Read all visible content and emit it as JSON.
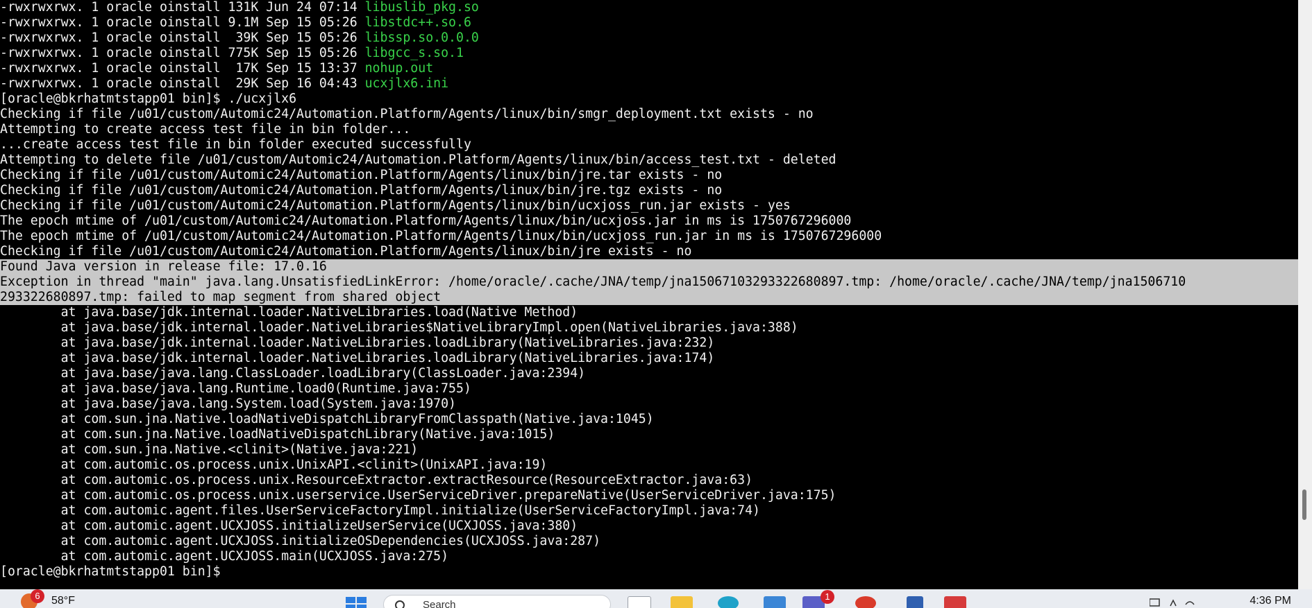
{
  "terminal": {
    "lines": [
      {
        "text": "-rwxrwxrwx. 1 oracle oinstall 131K Jun 24 07:14 ",
        "green": "libuslib_pkg.so"
      },
      {
        "text": "-rwxrwxrwx. 1 oracle oinstall 9.1M Sep 15 05:26 ",
        "green": "libstdc++.so.6"
      },
      {
        "text": "-rwxrwxrwx. 1 oracle oinstall  39K Sep 15 05:26 ",
        "green": "libssp.so.0.0.0"
      },
      {
        "text": "-rwxrwxrwx. 1 oracle oinstall 775K Sep 15 05:26 ",
        "green": "libgcc_s.so.1"
      },
      {
        "text": "-rwxrwxrwx. 1 oracle oinstall  17K Sep 15 13:37 ",
        "green": "nohup.out"
      },
      {
        "text": "-rwxrwxrwx. 1 oracle oinstall  29K Sep 16 04:43 ",
        "green": "ucxjlx6.ini"
      },
      {
        "text": "[oracle@bkrhatmtstapp01 bin]$ ./ucxjlx6"
      },
      {
        "text": "Checking if file /u01/custom/Automic24/Automation.Platform/Agents/linux/bin/smgr_deployment.txt exists - no"
      },
      {
        "text": "Attempting to create access test file in bin folder..."
      },
      {
        "text": "...create access test file in bin folder executed successfully"
      },
      {
        "text": "Attempting to delete file /u01/custom/Automic24/Automation.Platform/Agents/linux/bin/access_test.txt - deleted"
      },
      {
        "text": "Checking if file /u01/custom/Automic24/Automation.Platform/Agents/linux/bin/jre.tar exists - no"
      },
      {
        "text": "Checking if file /u01/custom/Automic24/Automation.Platform/Agents/linux/bin/jre.tgz exists - no"
      },
      {
        "text": "Checking if file /u01/custom/Automic24/Automation.Platform/Agents/linux/bin/ucxjoss_run.jar exists - yes"
      },
      {
        "text": "The epoch mtime of /u01/custom/Automic24/Automation.Platform/Agents/linux/bin/ucxjoss.jar in ms is 1750767296000"
      },
      {
        "text": "The epoch mtime of /u01/custom/Automic24/Automation.Platform/Agents/linux/bin/ucxjoss_run.jar in ms is 1750767296000"
      },
      {
        "text": "Checking if file /u01/custom/Automic24/Automation.Platform/Agents/linux/bin/jre exists - no"
      },
      {
        "text": "Found Java version in release file: 17.0.16",
        "selected": true
      },
      {
        "text": "Exception in thread \"main\" java.lang.UnsatisfiedLinkError: /home/oracle/.cache/JNA/temp/jna15067103293322680897.tmp: /home/oracle/.cache/JNA/temp/jna1506710",
        "selected": true
      },
      {
        "text": "293322680897.tmp: failed to map segment from shared object",
        "selected": true
      },
      {
        "text": "        at java.base/jdk.internal.loader.NativeLibraries.load(Native Method)"
      },
      {
        "text": "        at java.base/jdk.internal.loader.NativeLibraries$NativeLibraryImpl.open(NativeLibraries.java:388)"
      },
      {
        "text": "        at java.base/jdk.internal.loader.NativeLibraries.loadLibrary(NativeLibraries.java:232)"
      },
      {
        "text": "        at java.base/jdk.internal.loader.NativeLibraries.loadLibrary(NativeLibraries.java:174)"
      },
      {
        "text": "        at java.base/java.lang.ClassLoader.loadLibrary(ClassLoader.java:2394)"
      },
      {
        "text": "        at java.base/java.lang.Runtime.load0(Runtime.java:755)"
      },
      {
        "text": "        at java.base/java.lang.System.load(System.java:1970)"
      },
      {
        "text": "        at com.sun.jna.Native.loadNativeDispatchLibraryFromClasspath(Native.java:1045)"
      },
      {
        "text": "        at com.sun.jna.Native.loadNativeDispatchLibrary(Native.java:1015)"
      },
      {
        "text": "        at com.sun.jna.Native.<clinit>(Native.java:221)"
      },
      {
        "text": "        at com.automic.os.process.unix.UnixAPI.<clinit>(UnixAPI.java:19)"
      },
      {
        "text": "        at com.automic.os.process.unix.ResourceExtractor.extractResource(ResourceExtractor.java:63)"
      },
      {
        "text": "        at com.automic.os.process.unix.userservice.UserServiceDriver.prepareNative(UserServiceDriver.java:175)"
      },
      {
        "text": "        at com.automic.agent.files.UserServiceFactoryImpl.initialize(UserServiceFactoryImpl.java:74)"
      },
      {
        "text": "        at com.automic.agent.UCXJOSS.initializeUserService(UCXJOSS.java:380)"
      },
      {
        "text": "        at com.automic.agent.UCXJOSS.initializeOSDependencies(UCXJOSS.java:287)"
      },
      {
        "text": "        at com.automic.agent.UCXJOSS.main(UCXJOSS.java:275)"
      },
      {
        "text": "[oracle@bkrhatmtstapp01 bin]$ "
      }
    ],
    "colors": {
      "background": "#000000",
      "text": "#f2f2f2",
      "file_green": "#39d34a",
      "selection": "#c8c8c8"
    }
  },
  "taskbar": {
    "weather_badge": "6",
    "weather_temp": "58°F",
    "search_label": "Search",
    "app_badge": "1",
    "clock": "4:36 PM",
    "icons": [
      "windows-start-icon",
      "file-explorer-icon",
      "edge-browser-icon",
      "calendar-icon",
      "teams-icon",
      "chrome-icon",
      "remote-desktop-icon",
      "office-icon"
    ]
  }
}
